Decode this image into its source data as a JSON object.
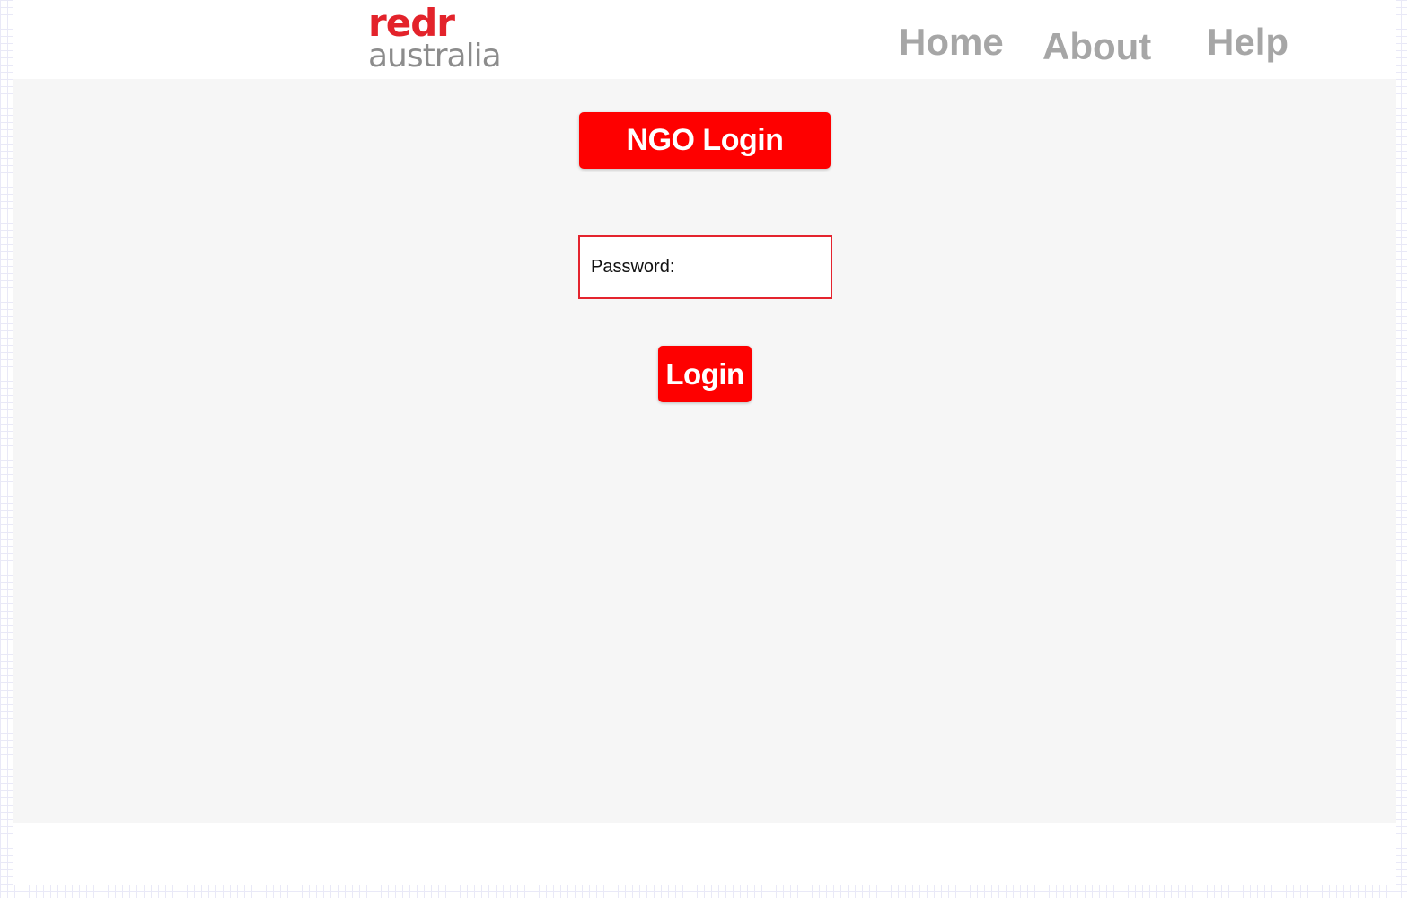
{
  "header": {
    "logo": {
      "brand_red": "redr",
      "brand_grey": "australia"
    },
    "nav": [
      {
        "label": "Home"
      },
      {
        "label": "About"
      },
      {
        "label": "Help"
      }
    ]
  },
  "main": {
    "title": "NGO Login",
    "password": {
      "label": "Password:",
      "value": "",
      "placeholder": ""
    },
    "login_button_label": "Login"
  },
  "colors": {
    "accent_red": "#fe0000",
    "logo_red": "#e3232b",
    "nav_grey": "#a6a6a6",
    "content_background": "#f6f6f6"
  }
}
